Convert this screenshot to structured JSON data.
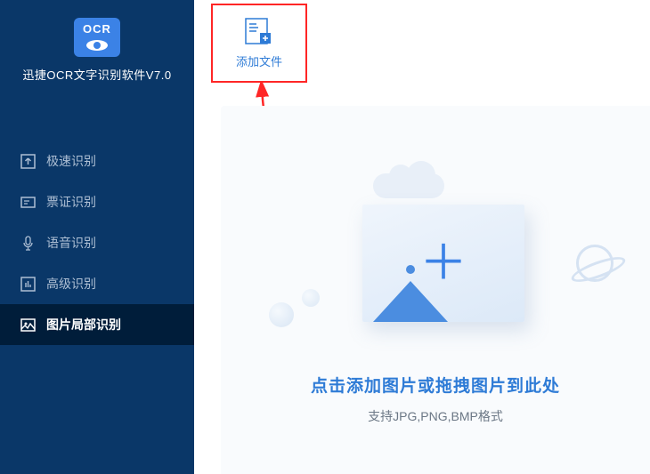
{
  "logo": {
    "text": "OCR"
  },
  "app_title": "迅捷OCR文字识别软件V7.0",
  "nav": {
    "items": [
      {
        "label": "极速识别"
      },
      {
        "label": "票证识别"
      },
      {
        "label": "语音识别"
      },
      {
        "label": "高级识别"
      },
      {
        "label": "图片局部识别"
      }
    ]
  },
  "toolbar": {
    "add_file_label": "添加文件"
  },
  "dropzone": {
    "title": "点击添加图片或拖拽图片到此处",
    "subtitle": "支持JPG,PNG,BMP格式"
  }
}
